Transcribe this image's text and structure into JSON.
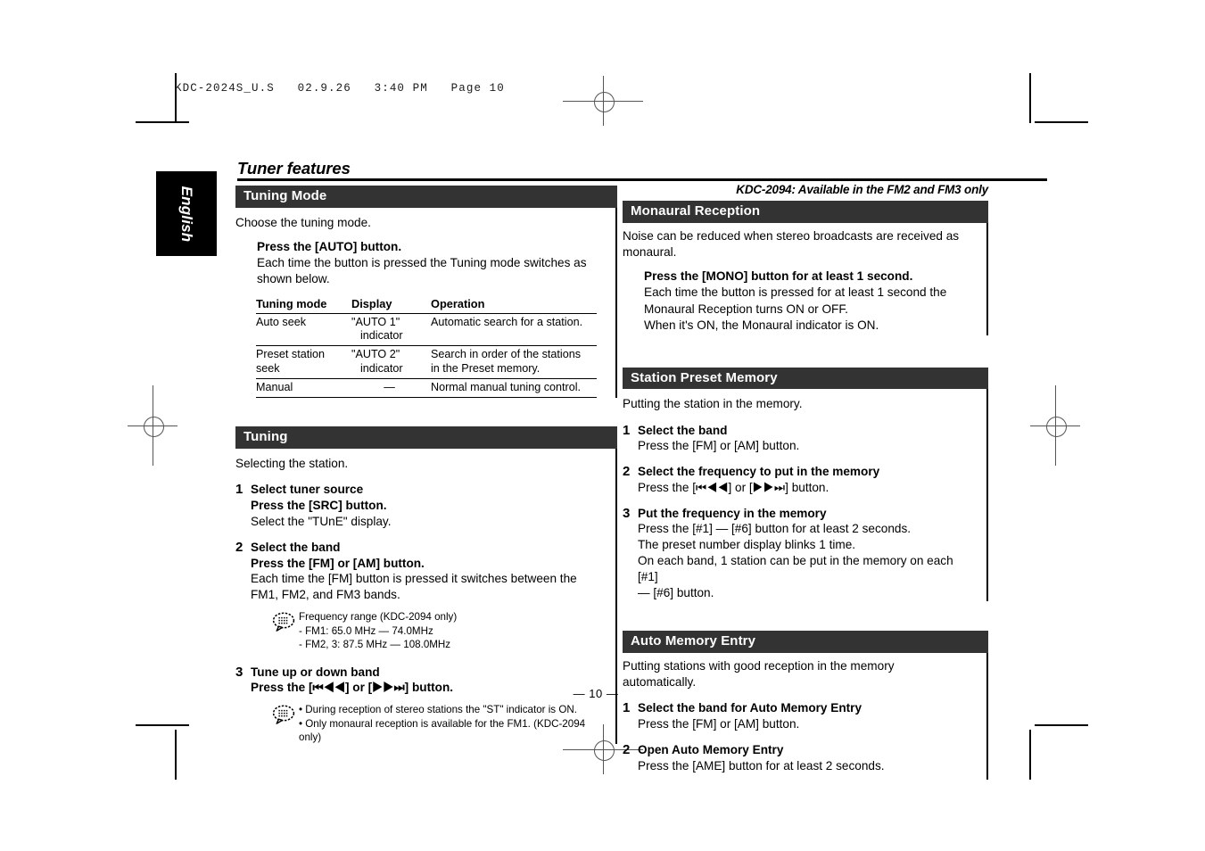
{
  "film_header": "KDC-2024S_U.S   02.9.26   3:40 PM   Page 10",
  "language_tab": "English",
  "page_title": "Tuner features",
  "kdc_note": "KDC-2094: Available in the FM2 and FM3 only",
  "page_number": "— 10 —",
  "colors": {
    "bar": "#333333",
    "tab": "#000000",
    "text": "#000000"
  },
  "left_column": {
    "tuning_mode": {
      "heading": "Tuning Mode",
      "lead": "Choose the tuning mode.",
      "instruction_bold": "Press the [AUTO] button.",
      "instruction_line1": "Each time the button is pressed the Tuning mode switches as",
      "instruction_line2": "shown below.",
      "table": {
        "headers": [
          "Tuning mode",
          "Display",
          "Operation"
        ],
        "rows": [
          {
            "mode": "Auto seek",
            "display": "\"AUTO 1\"",
            "display_sub": "indicator",
            "operation": "Automatic search for a station.",
            "operation2": ""
          },
          {
            "mode": "Preset station",
            "mode2": "seek",
            "display": "\"AUTO 2\"",
            "display_sub": "indicator",
            "operation": "Search in order of the stations",
            "operation2": "in the Preset memory."
          },
          {
            "mode": "Manual",
            "display": "—",
            "display_sub": "",
            "operation": "Normal manual tuning control.",
            "operation2": ""
          }
        ]
      }
    },
    "tuning": {
      "heading": "Tuning",
      "lead": "Selecting the station.",
      "steps": [
        {
          "num": "1",
          "title": "Select tuner source",
          "lines": [
            "Press the [SRC] button.",
            "Select the \"TUnE\" display."
          ]
        },
        {
          "num": "2",
          "title": "Select the band",
          "bold_lines": [
            "Press the [FM] or [AM] button."
          ],
          "lines": [
            "Each time the [FM] button is pressed it switches between the",
            "FM1, FM2, and FM3 bands."
          ],
          "note": {
            "icon": "note-bubble-icon",
            "lines": [
              "Frequency range (KDC-2094 only)",
              "- FM1: 65.0 MHz — 74.0MHz",
              "- FM2, 3: 87.5 MHz — 108.0MHz"
            ]
          }
        },
        {
          "num": "3",
          "title": "Tune up or down band",
          "bold_lines": [
            "Press the [⏮◀◀] or [▶▶⏭] button."
          ],
          "lines": [],
          "note": {
            "icon": "note-bubble-icon",
            "lines": [
              "• During reception of stereo stations the \"ST\" indicator is ON.",
              "• Only monaural reception is available for the FM1. (KDC-2094 only)"
            ]
          }
        }
      ]
    }
  },
  "right_column": {
    "monaural_reception": {
      "heading": "Monaural Reception",
      "lead1": "Noise can be reduced when stereo broadcasts are received as",
      "lead2": "monaural.",
      "instruction_bold": "Press the [MONO] button for at least 1 second.",
      "lines": [
        "Each time the button is pressed for at least 1 second the",
        "Monaural Reception turns ON or OFF.",
        "When it's ON, the Monaural indicator is ON."
      ]
    },
    "station_preset_memory": {
      "heading": "Station Preset Memory",
      "lead": "Putting the station in the memory.",
      "steps": [
        {
          "num": "1",
          "title": "Select the band",
          "lines": [
            "Press the [FM] or [AM] button."
          ]
        },
        {
          "num": "2",
          "title": "Select the frequency to put in the memory",
          "lines": [
            "Press the [⏮◀◀] or [▶▶⏭] button."
          ]
        },
        {
          "num": "3",
          "title": "Put the frequency in the memory",
          "bold_lines": [
            "Press the [#1] — [#6] button for at least 2 seconds."
          ],
          "lines": [
            "The preset number display blinks 1 time.",
            "On each band, 1 station can be put in the memory on each [#1]",
            "— [#6] button."
          ]
        }
      ]
    },
    "auto_memory_entry": {
      "heading": "Auto Memory Entry",
      "lead1": "Putting stations with good reception in the memory",
      "lead2": "automatically.",
      "steps": [
        {
          "num": "1",
          "title": "Select the band for Auto Memory Entry",
          "lines": [
            "Press the [FM] or [AM] button."
          ]
        },
        {
          "num": "2",
          "title": "Open Auto Memory Entry",
          "lines": [
            "Press the [AME] button for at least 2 seconds."
          ]
        }
      ]
    }
  }
}
